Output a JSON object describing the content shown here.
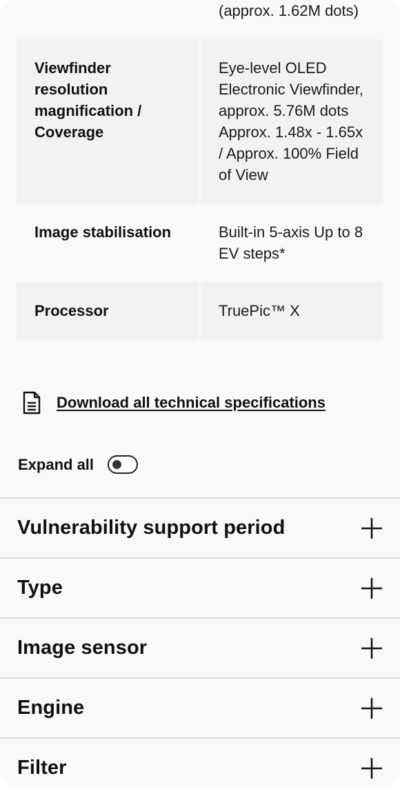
{
  "specs": [
    {
      "label": "",
      "value": "(approx. 1.62M dots)",
      "shaded": false
    },
    {
      "label": "Viewfinder resolution magnification / Coverage",
      "value": "Eye-level OLED Electronic Viewfinder, approx. 5.76M dots Approx. 1.48x - 1.65x / Approx. 100% Field of View",
      "shaded": true
    },
    {
      "label": "Image stabilisation",
      "value": "Built-in 5-axis Up to 8 EV steps*",
      "shaded": false
    },
    {
      "label": "Processor",
      "value": "TruePic™ X",
      "shaded": true
    }
  ],
  "download": {
    "icon": "document-icon",
    "label": "Download all technical specifications"
  },
  "expand_all": {
    "label": "Expand all",
    "toggle_state": "off"
  },
  "accordion": [
    {
      "title": "Vulnerability support period",
      "icon": "plus-icon"
    },
    {
      "title": "Type",
      "icon": "plus-icon"
    },
    {
      "title": "Image sensor",
      "icon": "plus-icon"
    },
    {
      "title": "Engine",
      "icon": "plus-icon"
    },
    {
      "title": "Filter",
      "icon": "plus-icon"
    }
  ],
  "colors": {
    "page_background": "#f9f9f9",
    "row_shade": "#f2f2f2",
    "text": "#111111",
    "divider": "#dddddd"
  }
}
